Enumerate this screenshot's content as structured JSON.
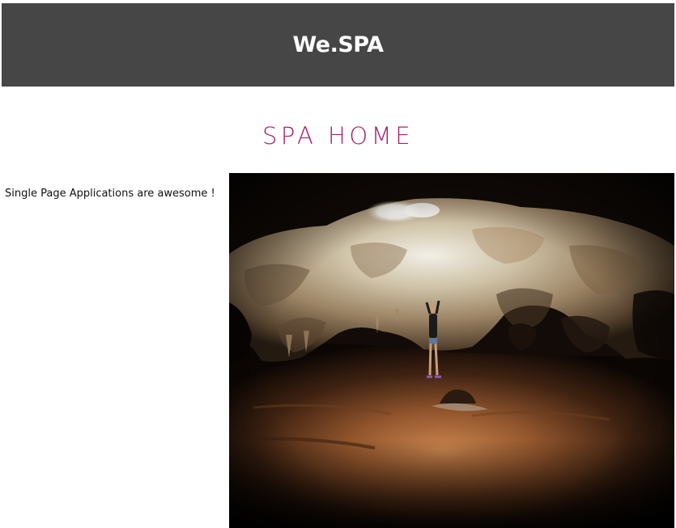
{
  "header": {
    "brand": "We.SPA",
    "bg_color": "#464646"
  },
  "page": {
    "title": "SPA HOME",
    "title_color": "#a8206b",
    "intro_text": "Single Page Applications are awesome !"
  },
  "hero_image": {
    "alt": "Cave"
  }
}
